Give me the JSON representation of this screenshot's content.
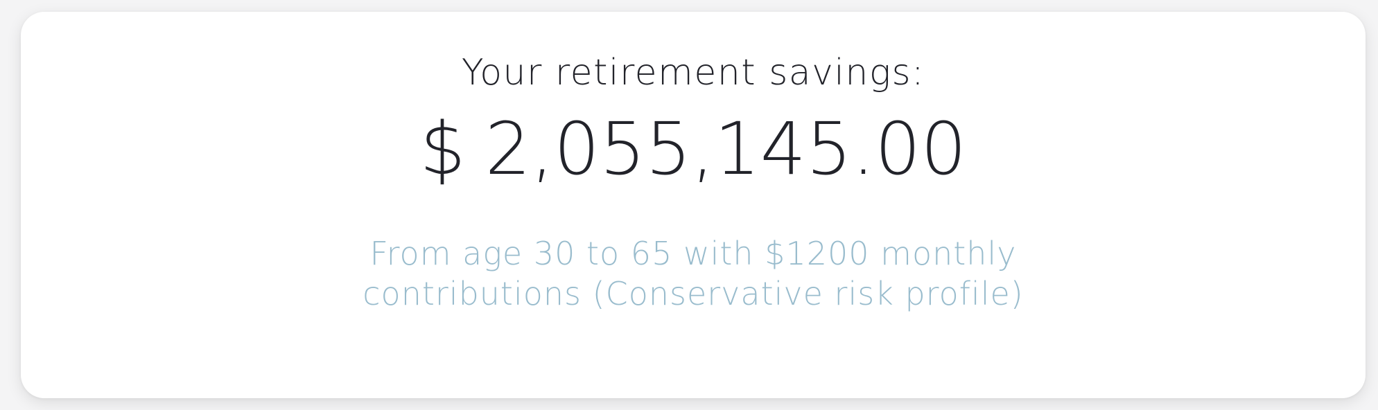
{
  "result": {
    "heading": "Your retirement savings:",
    "currency_symbol": "$",
    "amount": "2,055,145.00",
    "summary": "From age 30 to 65 with $1200 monthly contributions (Conservative risk profile)"
  },
  "colors": {
    "text_primary": "#22232a",
    "text_secondary": "#99bccd",
    "card_background": "#ffffff",
    "page_background": "#f4f4f5"
  }
}
